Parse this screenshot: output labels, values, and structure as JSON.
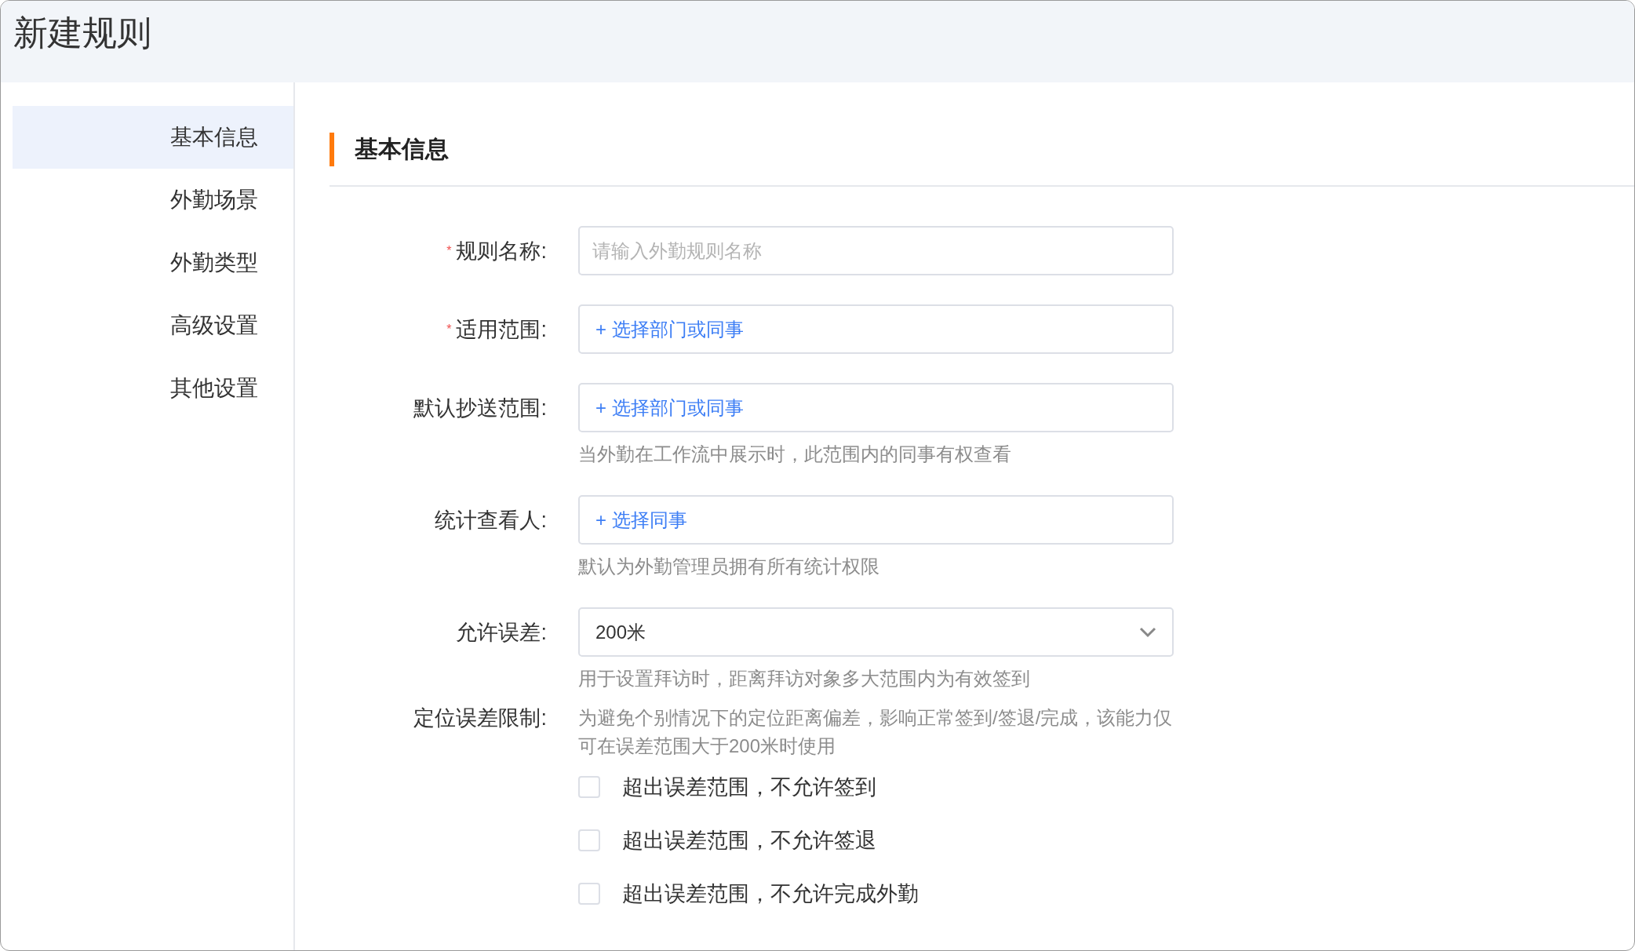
{
  "window": {
    "title": "新建规则"
  },
  "sidebar": {
    "items": [
      {
        "label": "基本信息",
        "selected": true
      },
      {
        "label": "外勤场景",
        "selected": false
      },
      {
        "label": "外勤类型",
        "selected": false
      },
      {
        "label": "高级设置",
        "selected": false
      },
      {
        "label": "其他设置",
        "selected": false
      }
    ]
  },
  "section": {
    "title": "基本信息"
  },
  "form": {
    "fields": [
      {
        "kind": "input",
        "label": "规则名称:",
        "required_mark": "*",
        "placeholder": "请输入外勤规则名称"
      },
      {
        "kind": "picker",
        "label": "适用范围:",
        "required_mark": "*",
        "value": "+ 选择部门或同事"
      },
      {
        "kind": "picker",
        "label": "默认抄送范围:",
        "value": "+ 选择部门或同事",
        "hint": "当外勤在工作流中展示时，此范围内的同事有权查看"
      },
      {
        "kind": "picker",
        "label": "统计查看人:",
        "value": "+ 选择同事",
        "hint": "默认为外勤管理员拥有所有统计权限"
      },
      {
        "kind": "select",
        "label": "允许误差:",
        "value": "200米",
        "hint": "用于设置拜访时，距离拜访对象多大范围内为有效签到"
      },
      {
        "kind": "checklist",
        "label": "定位误差限制:",
        "description": "为避免个别情况下的定位距离偏差，影响正常签到/签退/完成，该能力仅可在误差范围大于200米时使用",
        "options": [
          {
            "label": "超出误差范围，不允许签到",
            "checked": false
          },
          {
            "label": "超出误差范围，不允许签退",
            "checked": false
          },
          {
            "label": "超出误差范围，不允许完成外勤",
            "checked": false
          }
        ]
      }
    ]
  }
}
